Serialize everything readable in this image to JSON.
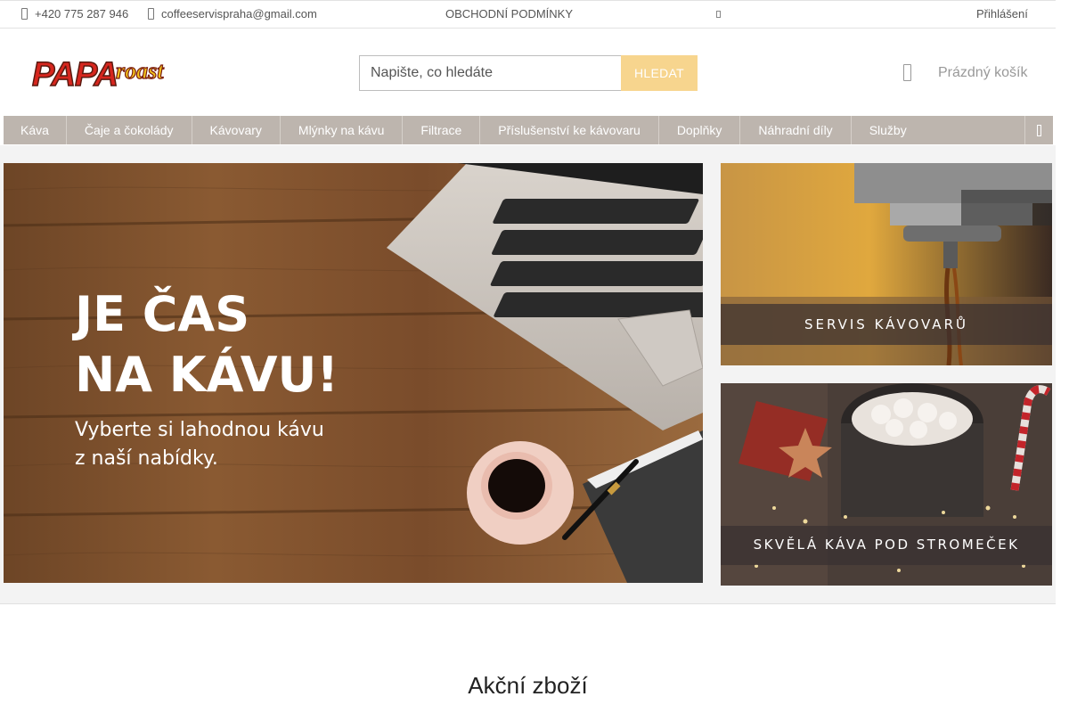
{
  "topbar": {
    "phone": "+420 775 287 946",
    "email": "coffeeservispraha@gmail.com",
    "terms": "OBCHODNÍ PODMÍNKY",
    "login": "Přihlášení"
  },
  "header": {
    "logo_text": "PAPA roast",
    "search_placeholder": "Napište, co hledáte",
    "search_button": "HLEDAT",
    "cart_label": "Prázdný košík"
  },
  "nav": {
    "items": [
      "Káva",
      "Čaje a čokolády",
      "Kávovary",
      "Mlýnky na kávu",
      "Filtrace",
      "Příslušenství ke kávovaru",
      "Doplňky",
      "Náhradní díly",
      "Služby"
    ]
  },
  "banners": {
    "main": {
      "line1": "JE ČAS",
      "line2": "NA KÁVU!",
      "sub1": "Vyberte si lahodnou kávu",
      "sub2": "z naší nabídky."
    },
    "service": {
      "label": "SERVIS KÁVOVARŮ"
    },
    "christmas": {
      "label": "SKVĚLÁ KÁVA POD STROMEČEK"
    }
  },
  "section": {
    "title": "Akční zboží"
  },
  "colors": {
    "nav_bg": "#bdb5ae",
    "search_button": "#f7d58e",
    "logo_red": "#d7261e",
    "logo_yellow": "#f2c21b"
  }
}
